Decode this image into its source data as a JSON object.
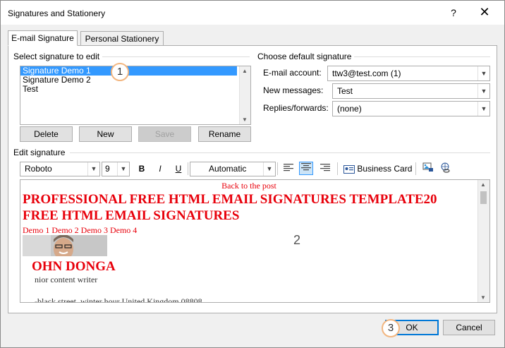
{
  "window": {
    "title": "Signatures and Stationery",
    "help_label": "?",
    "close_label": "✕"
  },
  "tabs": [
    {
      "label": "E-mail Signature",
      "active": true
    },
    {
      "label": "Personal Stationery",
      "active": false
    }
  ],
  "select_signature": {
    "label": "Select signature to edit",
    "items": [
      "Signature Demo 1",
      "Signature Demo 2",
      "Test"
    ],
    "selected_index": 0
  },
  "sig_buttons": {
    "delete": "Delete",
    "new": "New",
    "save": "Save",
    "rename": "Rename"
  },
  "default_signature": {
    "label": "Choose default signature",
    "email_account_label": "E-mail account:",
    "email_account_value": "ttw3@test.com (1)",
    "new_messages_label": "New messages:",
    "new_messages_value": "Test",
    "replies_label": "Replies/forwards:",
    "replies_value": "(none)"
  },
  "edit_signature": {
    "label": "Edit signature",
    "toolbar": {
      "font": "Roboto",
      "size": "9",
      "bold": "B",
      "italic": "I",
      "underline": "U",
      "color": "Automatic",
      "business_card": "Business Card"
    },
    "content": {
      "back_link": "Back to the post",
      "heading_line1": "PROFESSIONAL FREE HTML EMAIL SIGNATURES TEMPLATE20",
      "heading_line2": "FREE HTML EMAIL SIGNATURES",
      "demo_links": "Demo 1 Demo 2 Demo 3 Demo 4",
      "name": "OHN DONGA",
      "job_title": "nior content writer",
      "address": "-black street, winter hour United Kingdom 08808"
    }
  },
  "footer": {
    "ok": "OK",
    "cancel": "Cancel"
  },
  "markers": [
    "1",
    "2",
    "3"
  ],
  "colors": {
    "accent": "#0078d7",
    "selection": "#3399ff",
    "signature_red": "#e8000b",
    "marker_border": "#f2b680"
  }
}
